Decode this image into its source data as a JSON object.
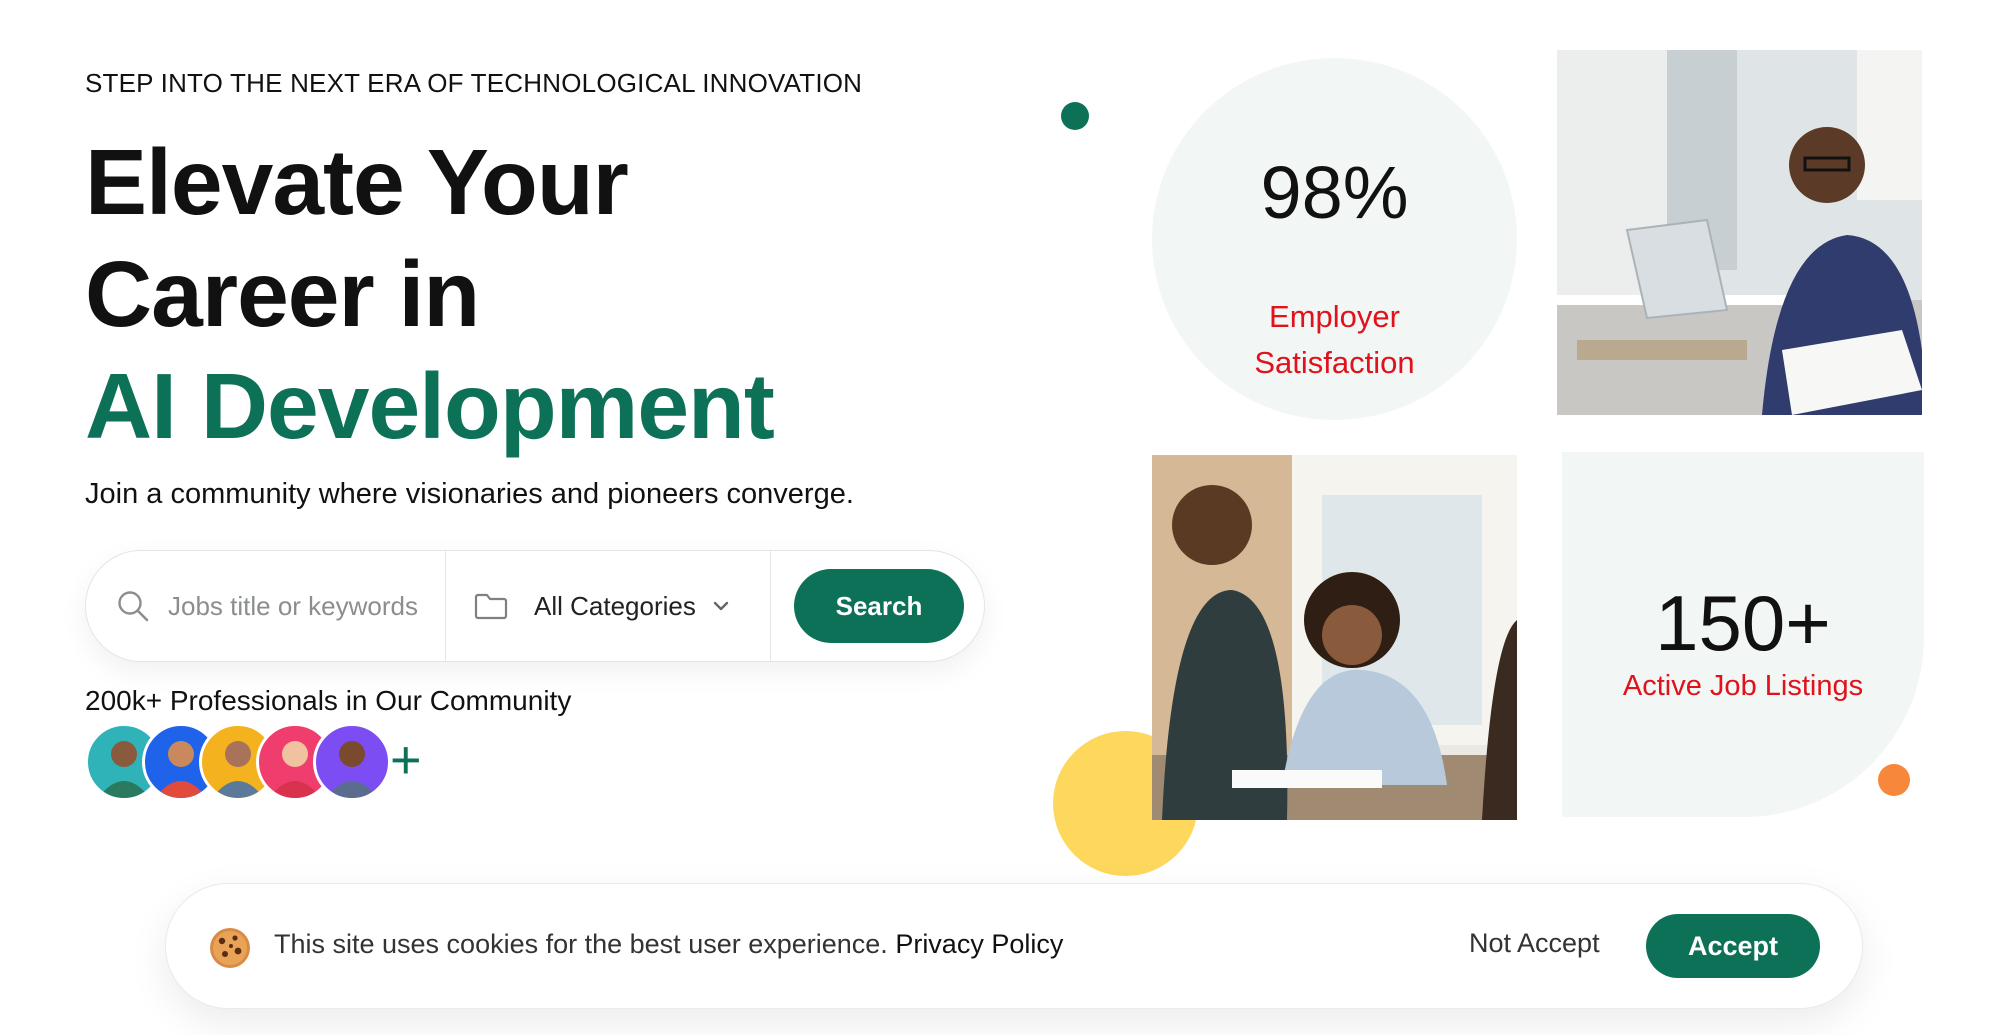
{
  "hero": {
    "eyebrow": "STEP INTO THE NEXT ERA OF TECHNOLOGICAL INNOVATION",
    "headline_line1": "Elevate Your",
    "headline_line2": "Career in",
    "headline_accent": "AI Development",
    "lede": "Join a community where visionaries and pioneers converge."
  },
  "search": {
    "placeholder": "Jobs title or keywords",
    "category_value": "All Categories",
    "button_label": "Search",
    "icons": {
      "search": "search-icon",
      "folder": "folder-icon",
      "chevron": "chevron-down-icon"
    }
  },
  "community": {
    "label": "200k+ Professionals in Our Community",
    "avatars": [
      {
        "name": "avatar-1",
        "bg": "#2fb3b8"
      },
      {
        "name": "avatar-2",
        "bg": "#1e63e9"
      },
      {
        "name": "avatar-3",
        "bg": "#f3b21e"
      },
      {
        "name": "avatar-4",
        "bg": "#ef3e6d"
      },
      {
        "name": "avatar-5",
        "bg": "#7c4df3"
      }
    ],
    "more_symbol": "+"
  },
  "stats": {
    "satisfaction_value": "98%",
    "satisfaction_label_line1": "Employer",
    "satisfaction_label_line2": "Satisfaction",
    "listings_value": "150+",
    "listings_label": "Active Job Listings"
  },
  "cookie": {
    "message": "This site uses cookies for the best user experience.",
    "policy_link": "Privacy Policy",
    "reject_label": "Not Accept",
    "accept_label": "Accept"
  },
  "colors": {
    "brand_green": "#0c7157",
    "stat_red": "#e0121b",
    "panel_bg": "#f2f6f4",
    "accent_yellow": "#fdd85c",
    "accent_orange": "#f7883b"
  }
}
